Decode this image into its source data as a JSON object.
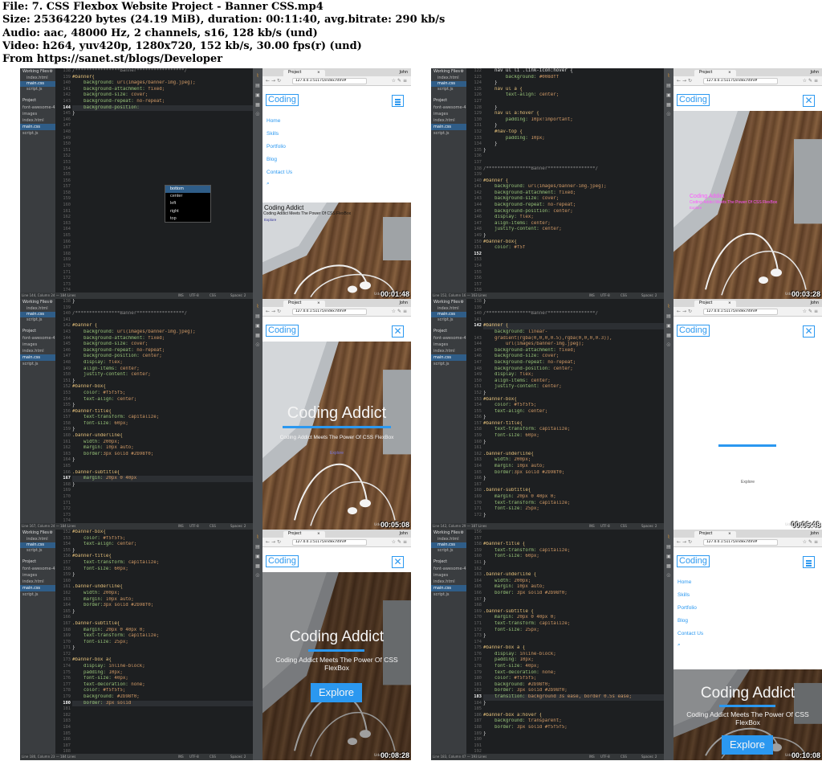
{
  "header": {
    "file": "File: 7. CSS Flexbox Website Project - Banner CSS.mp4",
    "size": "Size: 25364220 bytes (24.19 MiB), duration: 00:11:40, avg.bitrate: 290 kb/s",
    "audio": "Audio: aac, 48000 Hz, 2 channels, s16, 128 kb/s (und)",
    "video": "Video: h264, yuv420p, 1280x720, 152 kb/s, 30.00 fps(r) (und)",
    "from": "From https://sanet.st/blogs/Developer"
  },
  "common": {
    "working_files": "Working Files",
    "files": [
      "index.html",
      "main.css",
      "script.js"
    ],
    "project": "Project",
    "tree": [
      "font-awesome-4",
      "images",
      "index.html",
      "main.css",
      "script.js"
    ],
    "tab": "Project",
    "url": "127.0.0.1:51175/index.html#",
    "user": "John",
    "brand": "Coding",
    "nav": [
      "Home",
      "Skills",
      "Portfolio",
      "Blog",
      "Contact Us"
    ],
    "banner_title": "Coding Addict",
    "banner_sub": "Coding Addict Meets The Power Of CSS FlexBox",
    "explore": "Explore",
    "watermark": "Udemy",
    "status_ins": "INS",
    "status_enc": "UTF-8",
    "status_lang": "CSS",
    "status_spaces": "Spaces: 2",
    "accent": "#2b98f0"
  },
  "frames": [
    {
      "timestamp": "00:01:48",
      "statusline": "Line 144, Column 24 — 184 Lines",
      "gutter": [
        "138",
        "139",
        "140",
        "141",
        "142",
        "143",
        "144",
        "145",
        "146",
        "147",
        "148",
        "149",
        "150",
        "151",
        "152",
        "153",
        "154",
        "155",
        "156",
        "157",
        "158",
        "159",
        "160",
        "161",
        "162",
        "163",
        "164",
        "165",
        "166",
        "167",
        "168",
        "169",
        "170",
        "171",
        "172",
        "173",
        "174"
      ],
      "autocomplete": [
        "bottom",
        "center",
        "left",
        "right",
        "top"
      ]
    },
    {
      "timestamp": "00:03:28",
      "statusline": "Line 152, Column 16 — 163 Lines",
      "gutter": [
        "122",
        "123",
        "124",
        "125",
        "126",
        "127",
        "128",
        "129",
        "130",
        "131",
        "132",
        "133",
        "134",
        "135",
        "136",
        "137",
        "138",
        "139",
        "140",
        "141",
        "142",
        "143",
        "144",
        "145",
        "146",
        "147",
        "148",
        "149",
        "150",
        "151",
        "152",
        "153",
        "154",
        "155",
        "156",
        "157",
        "158"
      ]
    },
    {
      "timestamp": "00:05:08",
      "statusline": "Line 167, Column 24 — 184 Lines",
      "gutter": [
        "138",
        "139",
        "140",
        "141",
        "142",
        "143",
        "144",
        "145",
        "146",
        "147",
        "148",
        "149",
        "150",
        "151",
        "152",
        "153",
        "154",
        "155",
        "156",
        "157",
        "158",
        "159",
        "160",
        "161",
        "162",
        "163",
        "164",
        "165",
        "166",
        "167",
        "168",
        "169",
        "170",
        "171",
        "172",
        "173",
        "174"
      ]
    },
    {
      "timestamp": "00:06:48",
      "statusline": "Line 142, Column 29 — 187 Lines",
      "gutter": [
        "138",
        "139",
        "140",
        "141",
        "142",
        "",
        "143",
        "144",
        "145",
        "146",
        "147",
        "148",
        "149",
        "150",
        "151",
        "152",
        "153",
        "154",
        "155",
        "156",
        "157",
        "158",
        "159",
        "160",
        "161",
        "162",
        "163",
        "164",
        "165",
        "166",
        "167",
        "168",
        "169",
        "170",
        "171",
        "172"
      ]
    },
    {
      "timestamp": "00:08:28",
      "statusline": "Line 180, Column 23 — 184 Lines",
      "gutter": [
        "152",
        "153",
        "154",
        "155",
        "156",
        "157",
        "158",
        "159",
        "160",
        "161",
        "162",
        "163",
        "164",
        "165",
        "166",
        "167",
        "168",
        "169",
        "170",
        "171",
        "172",
        "173",
        "174",
        "175",
        "176",
        "177",
        "178",
        "179",
        "180",
        "181",
        "182",
        "183",
        "184",
        "185",
        "186",
        "187",
        "188"
      ]
    },
    {
      "timestamp": "00:10:08",
      "statusline": "Line 183, Column 47 — 193 Lines",
      "gutter": [
        "156",
        "157",
        "158",
        "159",
        "160",
        "161",
        "162",
        "163",
        "164",
        "165",
        "166",
        "167",
        "168",
        "169",
        "170",
        "171",
        "172",
        "173",
        "174",
        "175",
        "176",
        "177",
        "178",
        "179",
        "180",
        "181",
        "182",
        "183",
        "184",
        "185",
        "186",
        "187",
        "188",
        "189",
        "190",
        "191",
        "192"
      ]
    }
  ]
}
